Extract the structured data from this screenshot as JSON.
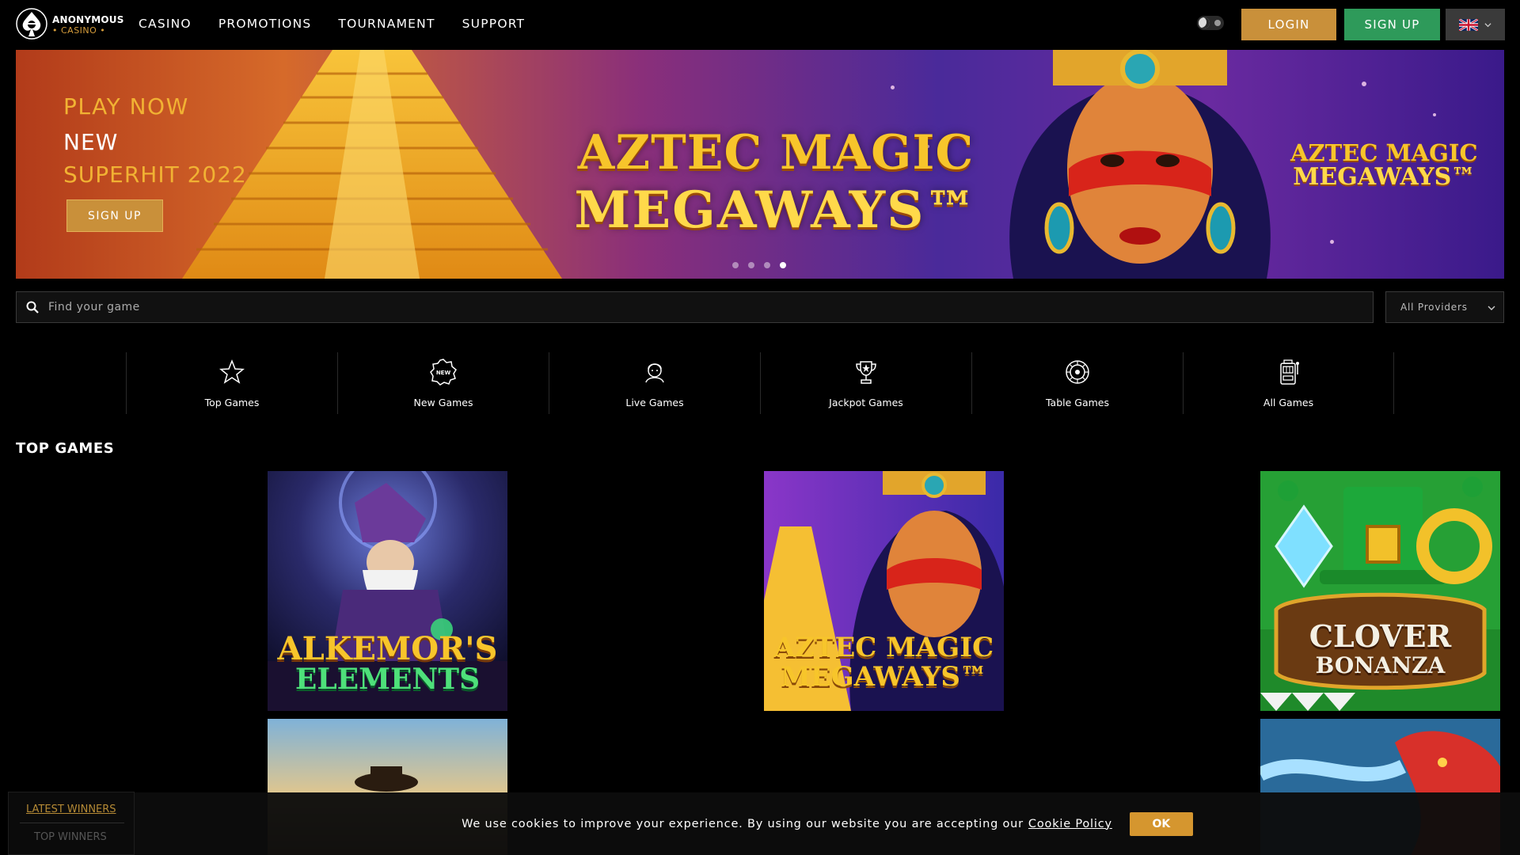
{
  "brand": {
    "name": "ANONYMOUS",
    "sub": "• CASINO •"
  },
  "nav": {
    "items": [
      "CASINO",
      "PROMOTIONS",
      "TOURNAMENT",
      "SUPPORT"
    ]
  },
  "header": {
    "login_label": "LOGIN",
    "signup_label": "SIGN UP",
    "language_icon": "uk-flag-icon"
  },
  "banner": {
    "line1": "PLAY NOW",
    "line2": "NEW",
    "line3": "SUPERHIT 2022",
    "button_label": "SIGN UP",
    "game_logo_line1": "AZTEC MAGIC",
    "game_logo_line2": "MEGAWAYS™",
    "slides": 4,
    "active_slide": 4
  },
  "search": {
    "placeholder": "Find your game",
    "providers_label": "All Providers"
  },
  "categories": [
    {
      "label": "Top Games",
      "icon": "star-icon"
    },
    {
      "label": "New Games",
      "icon": "new-badge-icon"
    },
    {
      "label": "Live Games",
      "icon": "live-dealer-icon"
    },
    {
      "label": "Jackpot Games",
      "icon": "trophy-icon"
    },
    {
      "label": "Table Games",
      "icon": "roulette-icon"
    },
    {
      "label": "All Games",
      "icon": "slot-machine-icon"
    }
  ],
  "section": {
    "title": "TOP GAMES"
  },
  "games": [
    {
      "title_line1": "ALKEMOR'S",
      "title_line2": "ELEMENTS"
    },
    {
      "title_line1": "AZTEC MAGIC",
      "title_line2": "MEGAWAYS™"
    },
    {
      "title_line1": "CLOVER",
      "title_line2": "BONANZA"
    }
  ],
  "winners": {
    "latest_label": "LATEST WINNERS",
    "top_label": "TOP WINNERS"
  },
  "cookie": {
    "text": "We use cookies to improve your experience. By using our website you are accepting our",
    "link": "Cookie Policy",
    "ok_label": "OK"
  },
  "colors": {
    "accent_gold": "#c9903a",
    "signup_green": "#2e9a5a",
    "background": "#000000"
  }
}
